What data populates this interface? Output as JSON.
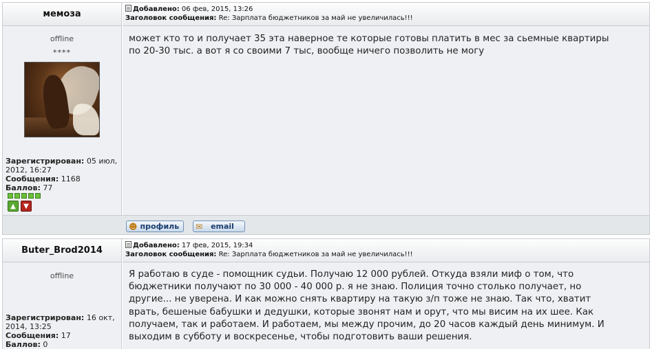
{
  "posts": [
    {
      "username": "мемоза",
      "status": "offline",
      "rank": "****",
      "registered_label": "Зарегистрирован:",
      "registered_value": "05 июл, 2012, 16:27",
      "messages_label": "Сообщения:",
      "messages_value": "1168",
      "points_label": "Баллов:",
      "points_value": "77",
      "added_label": "Добавлено:",
      "added_value": "06 фев, 2015, 13:26",
      "subject_label": "Заголовок сообщения:",
      "subject_value": "Re: Зарплата бюджетников за май не увеличилась!!!",
      "body_lines": [
        "может кто то и получает 35 эта наверное те которые готовы платить в мес за сьемные квартиры",
        "по 20-30 тыс. а вот я со своими 7 тыс, вообще ничего позволить не могу"
      ],
      "profile_button": "профиль",
      "email_button": "email"
    },
    {
      "username": "Buter_Brod2014",
      "status": "offline",
      "registered_label": "Зарегистрирован:",
      "registered_value": "16 окт, 2014, 13:25",
      "messages_label": "Сообщения:",
      "messages_value": "17",
      "points_label": "Баллов:",
      "points_value": "0",
      "added_label": "Добавлено:",
      "added_value": "17 фев, 2015, 19:34",
      "subject_label": "Заголовок сообщения:",
      "subject_value": "Re: Зарплата бюджетников за май не увеличилась!!!",
      "body_lines": [
        "Я работаю в суде - помощник судьи. Получаю 12 000 рублей. Откуда взяли миф о том, что",
        "бюджетники получают по 30 000 - 40 000 р. я не знаю. Полиция точно столько получает, но",
        "другие... не уверена. И как можно снять квартиру на такую з/п тоже не знаю. Так что, хватит",
        "врать, бешеные бабушки и дедушки, которые звонят нам и орут, что мы висим на их шее. Как",
        "получаем, так и работаем. И работаем, мы между прочим, до 20 часов каждый день минимум. И",
        "выходим в субботу и воскресенье, чтобы подготовить ваши решения."
      ]
    }
  ],
  "icons": {
    "post": "document-icon",
    "thumb_up": "thumb-up-icon",
    "thumb_down": "thumb-down-icon",
    "profile": "profile-icon",
    "email": "envelope-icon"
  },
  "colors": {
    "panel": "#eef0f3",
    "border": "#c8ccd2",
    "button_text": "#1c3d6e",
    "star_green": "#6bbf3a"
  }
}
